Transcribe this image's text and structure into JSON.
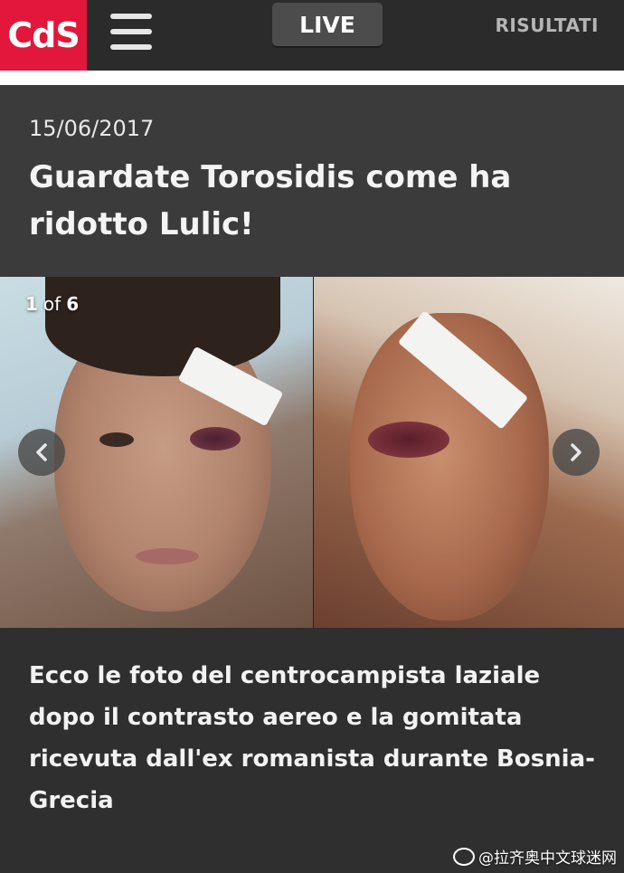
{
  "header": {
    "logo_text": "CdS",
    "live_label": "LIVE",
    "results_label": "RISULTATI"
  },
  "article": {
    "date": "15/06/2017",
    "title": "Guardate Torosidis come ha ridotto Lulic!",
    "caption": "Ecco le foto del centrocampista laziale dopo il contrasto aereo e la gomitata ricevuta dall'ex romanista durante Bosnia-Grecia"
  },
  "gallery": {
    "current": "1",
    "of_label": "of",
    "total": "6",
    "prev_icon": "chevron-left-icon",
    "next_icon": "chevron-right-icon"
  },
  "watermark": {
    "text": "@拉齐奥中文球迷网"
  },
  "colors": {
    "brand_red": "#e3163b",
    "background": "#2f2f2f",
    "header_band": "#3b3b3b"
  }
}
